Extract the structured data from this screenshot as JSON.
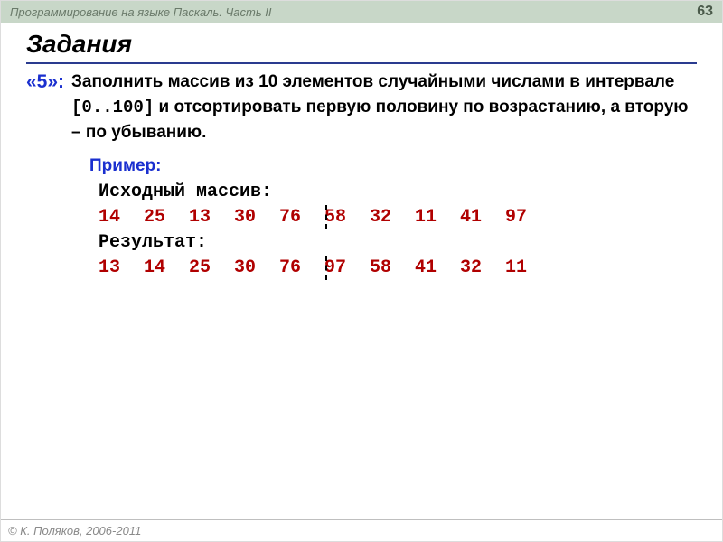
{
  "header": {
    "title": "Программирование на языке Паскаль. Часть II",
    "page_number": "63"
  },
  "section_title": "Задания",
  "task": {
    "grade_label": "«5»:",
    "text_1": "Заполнить массив из 10 элементов случайными числами в интервале ",
    "range": "[0..100]",
    "text_2": " и отсортировать первую половину по возрастанию, а вторую – по убыванию."
  },
  "example": {
    "label": "Пример:",
    "source_label": "Исходный массив:",
    "source_values": [
      "14",
      "25",
      "13",
      "30",
      "76",
      "58",
      "32",
      "11",
      "41",
      "97"
    ],
    "result_label": "Результат:",
    "result_values": [
      "13",
      "14",
      "25",
      "30",
      "76",
      "97",
      "58",
      "41",
      "32",
      "11"
    ]
  },
  "footer": "© К. Поляков, 2006-2011"
}
